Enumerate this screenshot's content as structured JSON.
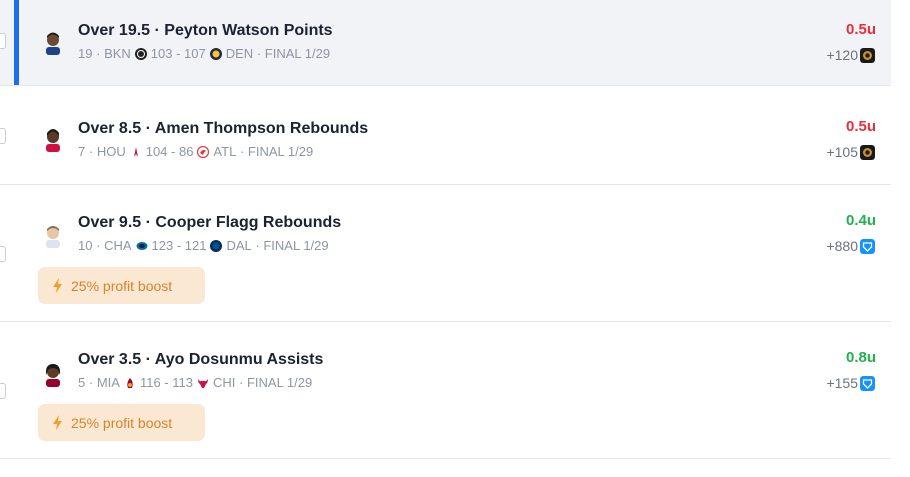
{
  "colors": {
    "loss": "#e5303b",
    "win": "#22b24c",
    "accent": "#1f6feb",
    "boost_bg": "#fbe8d3",
    "boost_text": "#d9822b"
  },
  "bets": [
    {
      "title": "Over 19.5 · Peyton Watson Points",
      "number": "19",
      "sep1": "·",
      "team_a": "BKN",
      "team_a_logo": "nets-logo-icon",
      "score": "103 - 107",
      "team_b": "DEN",
      "team_b_logo": "nuggets-logo-icon",
      "sep2": "·",
      "status": "FINAL 1/29",
      "units": "0.5u",
      "result": "loss",
      "odds": "+120",
      "book_icon": "bet365-icon"
    },
    {
      "title": "Over 8.5 · Amen Thompson Rebounds",
      "number": "7",
      "sep1": "·",
      "team_a": "HOU",
      "team_a_logo": "rockets-logo-icon",
      "score": "104 - 86",
      "team_b": "ATL",
      "team_b_logo": "hawks-logo-icon",
      "sep2": "·",
      "status": "FINAL 1/29",
      "units": "0.5u",
      "result": "loss",
      "odds": "+105",
      "book_icon": "bet365-icon"
    },
    {
      "title": "Over 9.5 · Cooper Flagg Rebounds",
      "number": "10",
      "sep1": "·",
      "team_a": "CHA",
      "team_a_logo": "hornets-logo-icon",
      "score": "123 - 121",
      "team_b": "DAL",
      "team_b_logo": "mavericks-logo-icon",
      "sep2": "·",
      "status": "FINAL 1/29",
      "units": "0.4u",
      "result": "win",
      "odds": "+880",
      "book_icon": "fanduel-icon",
      "boost": "25% profit boost"
    },
    {
      "title": "Over 3.5 · Ayo Dosunmu Assists",
      "number": "5",
      "sep1": "·",
      "team_a": "MIA",
      "team_a_logo": "heat-logo-icon",
      "score": "116 - 113",
      "team_b": "CHI",
      "team_b_logo": "bulls-logo-icon",
      "sep2": "·",
      "status": "FINAL 1/29",
      "units": "0.8u",
      "result": "win",
      "odds": "+155",
      "book_icon": "fanduel-icon",
      "boost": "25% profit boost"
    }
  ]
}
